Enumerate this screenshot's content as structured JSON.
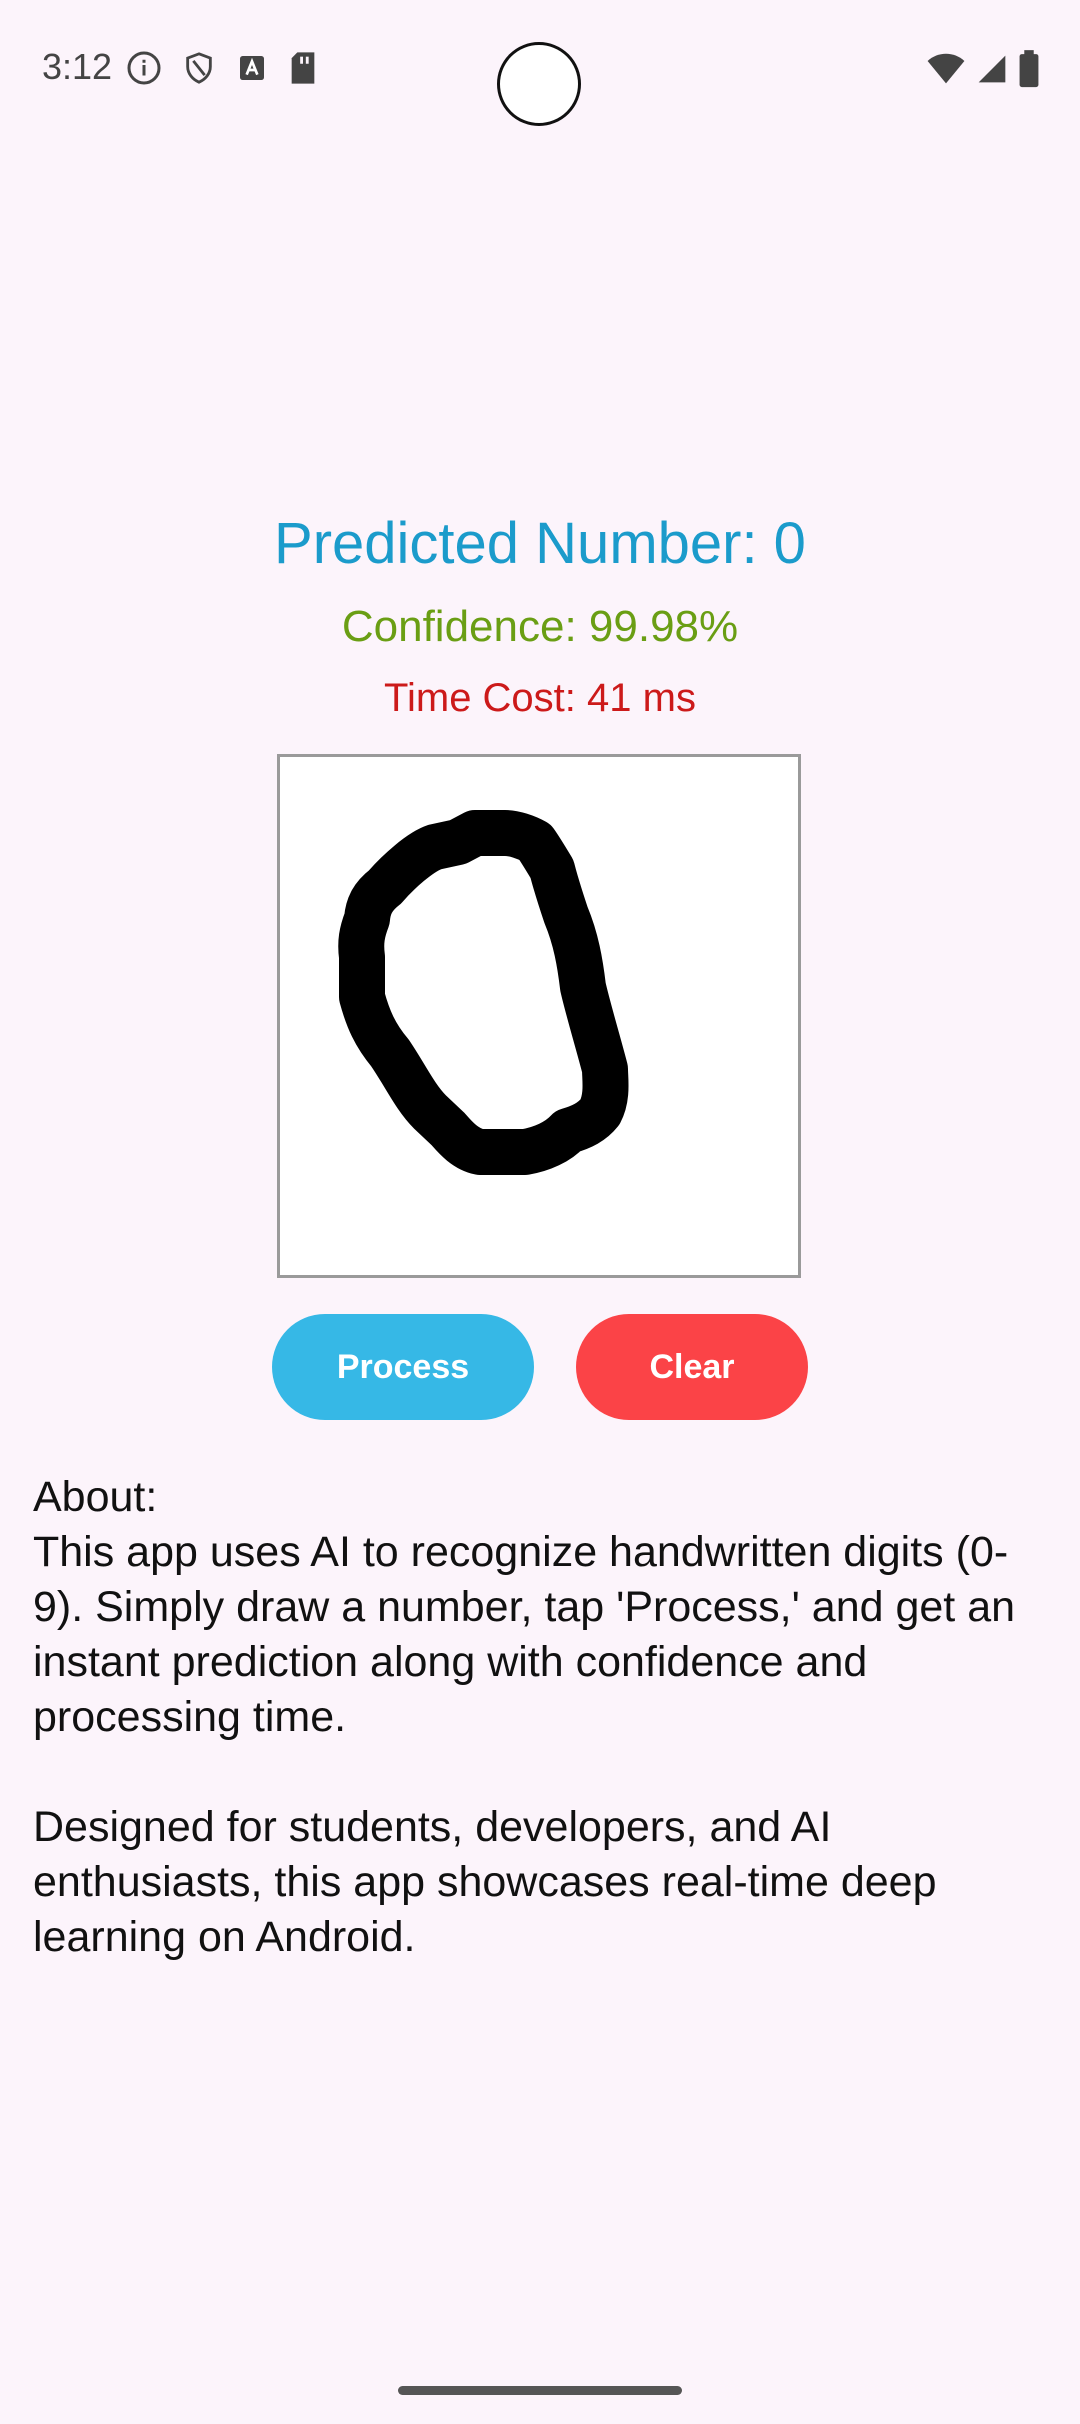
{
  "status_bar": {
    "time": "3:12",
    "left_icons": [
      "info-icon",
      "shield-icon",
      "keyboard-a-icon",
      "sd-card-icon"
    ],
    "right_icons": [
      "wifi-icon",
      "signal-icon",
      "battery-icon"
    ]
  },
  "result": {
    "predicted": "Predicted Number: 0",
    "confidence": "Confidence: 99.98%",
    "time_cost": "Time Cost: 41 ms"
  },
  "buttons": {
    "process": "Process",
    "clear": "Clear"
  },
  "about": {
    "heading": "About:",
    "paragraph1": "This app uses AI to recognize handwritten digits (0-9). Simply draw a number, tap 'Process,' and get an instant prediction along with confidence and processing time.",
    "paragraph2": "Designed for students, developers, and AI enthusiasts, this app showcases real-time deep learning on Android."
  },
  "colors": {
    "background": "#fcf4fb",
    "predicted": "#1b9bcb",
    "confidence": "#6a9e14",
    "time_cost": "#cc1a1a",
    "process_button": "#36b8e6",
    "clear_button": "#fb4347"
  }
}
